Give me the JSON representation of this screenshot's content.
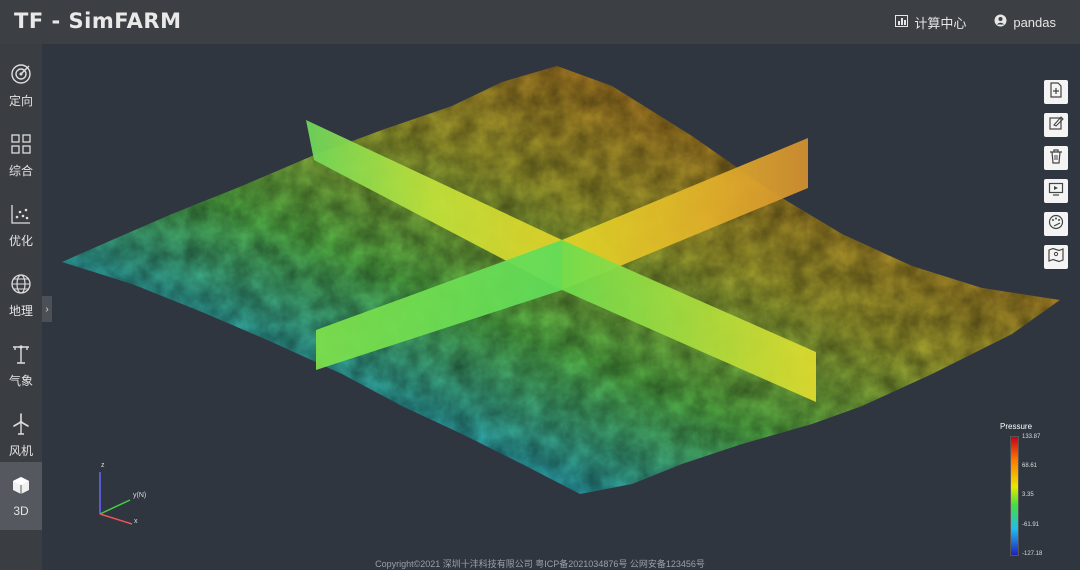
{
  "app": {
    "logo": "TF - SimFARM"
  },
  "header": {
    "compute_center": "计算中心",
    "user": "pandas"
  },
  "sidebar": {
    "items": [
      {
        "label": "定向",
        "icon": "target-icon"
      },
      {
        "label": "综合",
        "icon": "grid-icon"
      },
      {
        "label": "优化",
        "icon": "scatter-icon"
      },
      {
        "label": "地理",
        "icon": "globe-icon"
      },
      {
        "label": "气象",
        "icon": "mast-icon"
      },
      {
        "label": "风机",
        "icon": "wind-turbine-icon"
      },
      {
        "label": "3D",
        "icon": "cube-icon",
        "active": true
      }
    ]
  },
  "toolbar": {
    "tools": [
      "new-file-icon",
      "edit-icon",
      "delete-icon",
      "screen-icon",
      "palette-icon",
      "map-icon"
    ]
  },
  "legend": {
    "title": "Pressure",
    "ticks": [
      "133.87",
      "68.61",
      "3.35",
      "-61.91",
      "-127.18"
    ]
  },
  "axes": {
    "z": "z",
    "y": "y(N)",
    "x": "x"
  },
  "footer": {
    "text": "Copyright©2021 深圳十沣科技有限公司  粤ICP备2021034876号  公网安备123456号"
  },
  "colors": {
    "topbar": "#3c3f43",
    "background": "#2f3640",
    "sidebar": "#3a3d42",
    "active": "#55595f"
  }
}
